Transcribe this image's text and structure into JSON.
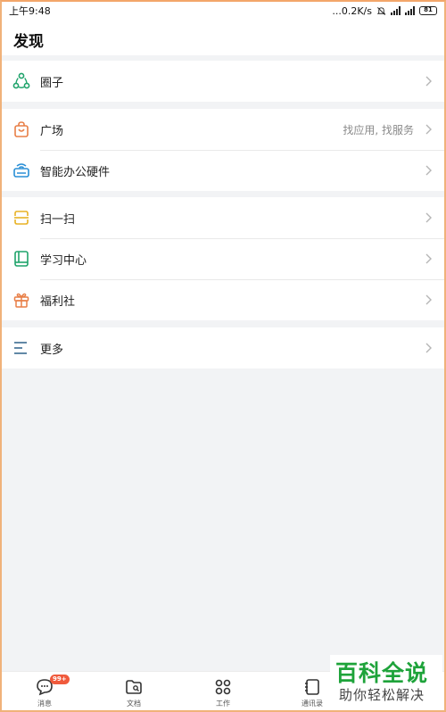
{
  "status_bar": {
    "time": "上午9:48",
    "network_speed": "...0.2K/s",
    "battery": "81"
  },
  "header": {
    "title": "发现"
  },
  "groups": [
    {
      "items": [
        {
          "label": "圈子",
          "icon": "circle-nodes-icon"
        }
      ]
    },
    {
      "items": [
        {
          "label": "广场",
          "hint": "找应用, 找服务",
          "icon": "shopping-bag-icon"
        },
        {
          "label": "智能办公硬件",
          "icon": "wifi-device-icon"
        }
      ]
    },
    {
      "items": [
        {
          "label": "扫一扫",
          "icon": "scan-icon"
        },
        {
          "label": "学习中心",
          "icon": "book-icon"
        },
        {
          "label": "福利社",
          "icon": "gift-icon"
        }
      ]
    },
    {
      "items": [
        {
          "label": "更多",
          "icon": "menu-lines-icon"
        }
      ]
    }
  ],
  "tabs": [
    {
      "label": "消息",
      "badge": "99+",
      "icon": "chat-bubble-icon"
    },
    {
      "label": "文档",
      "icon": "folder-icon"
    },
    {
      "label": "工作",
      "icon": "grid-icon"
    },
    {
      "label": "通讯录",
      "icon": "contacts-book-icon"
    }
  ],
  "watermark": {
    "title": "百科全说",
    "subtitle": "助你轻松解决"
  },
  "colors": {
    "green": "#1fa36b",
    "orange": "#e87e46",
    "blue": "#2a8fd6",
    "yellow": "#e8b225",
    "text": "#222222",
    "hint": "#8a8a8a",
    "background": "#f2f3f5",
    "badge": "#f05a3c",
    "watermark_green": "#1ea33a"
  }
}
